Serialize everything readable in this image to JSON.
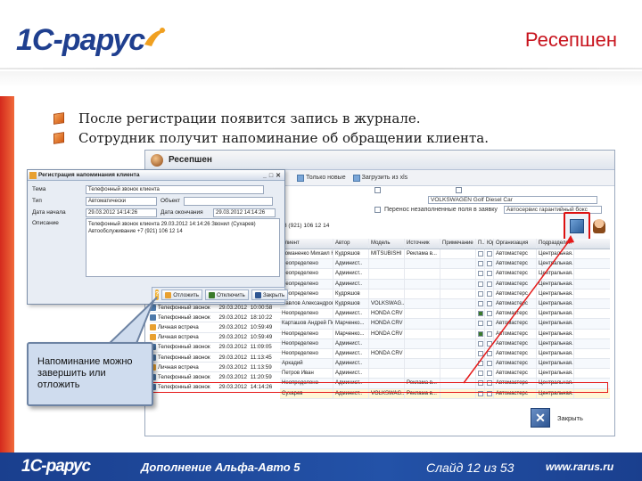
{
  "header": {
    "logo_text": "1С-рарус",
    "slide_title": "Ресепшен"
  },
  "bullets": [
    "После регистрации появится запись в журнале.",
    "Сотрудник получит напоминание об обращении клиента."
  ],
  "app_window": {
    "title": "Ресепшен",
    "toolbar": [
      "Только новые",
      "Загрузить из xls"
    ],
    "filters": {
      "interest_value": "VOLKSWAGEN Golf Diesel Car",
      "phone": "8 (921) 106 12 14",
      "checkbox_label": "Перенос незаполненные поля в заявку",
      "field_value": "Автосервис гарантийный бокс"
    },
    "table": {
      "columns": [
        "Клиент",
        "Автор",
        "Модель",
        "Источник",
        "Примечание",
        "П..",
        "Юр",
        "Организация",
        "Подразделе.."
      ],
      "rows": [
        [
          "Романенко Михаил Юрьевич",
          "Кудряшов",
          "MITSUBISHI",
          "Реклама в...",
          "",
          "",
          "",
          "Автомастерс",
          "Центральная..."
        ],
        [
          "Неопределено",
          "Админист..",
          "",
          "",
          "",
          "",
          "",
          "Автомастерс",
          "Центральная..."
        ],
        [
          "Неопределено",
          "Админист..",
          "",
          "",
          "",
          "",
          "",
          "Автомастерс",
          "Центральная..."
        ],
        [
          "Неопределено",
          "Админист..",
          "",
          "",
          "",
          "",
          "",
          "Автомастерс",
          "Центральная..."
        ],
        [
          "Неопределено",
          "Кудряшов",
          "",
          "",
          "",
          "",
          "",
          "Автомастерс",
          "Центральная..."
        ],
        [
          "Павлов Александрович",
          "Кудряшов",
          "VOLKSWAG...",
          "",
          "",
          "",
          "",
          "Автомастерс",
          "Центральная..."
        ],
        [
          "Неопределено",
          "Админист..",
          "HONDA CRV",
          "",
          "",
          "",
          "",
          "Автомастерс",
          "Центральная..."
        ],
        [
          "Карташов Андрей Петрович",
          "Марченко...",
          "HONDA CRV",
          "",
          "",
          "",
          "",
          "Автомастерс",
          "Центральная..."
        ],
        [
          "Неопределено",
          "Марченко...",
          "HONDA CRV",
          "",
          "",
          "",
          "",
          "Автомастерс",
          "Центральная..."
        ],
        [
          "Неопределено",
          "Админист..",
          "",
          "",
          "",
          "",
          "",
          "Автомастерс",
          "Центральная..."
        ],
        [
          "Неопределено",
          "Админист..",
          "HONDA CRV",
          "",
          "",
          "",
          "",
          "Автомастерс",
          "Центральная..."
        ],
        [
          "Аркадий",
          "Админист..",
          "",
          "",
          "",
          "",
          "",
          "Автомастерс",
          "Центральная..."
        ],
        [
          "Петров Иван",
          "Админист..",
          "",
          "",
          "",
          "",
          "",
          "Автомастерс",
          "Центральная..."
        ],
        [
          "Неопределено",
          "Админист..",
          "",
          "Реклама в...",
          "",
          "",
          "",
          "Автомастерс",
          "Центральная..."
        ],
        [
          "Сухарев",
          "Админист..",
          "VOLKSWAG...",
          "Реклама в...",
          "",
          "",
          "",
          "Автомастерс",
          "Центральная..."
        ]
      ],
      "checked_rows": [
        6,
        8
      ]
    },
    "event_list": [
      {
        "type": "Телефонный звонок",
        "date": "29.03.2012",
        "time": "10:00:58"
      },
      {
        "type": "Телефонный звонок",
        "date": "29.03.2012",
        "time": "18:10:22"
      },
      {
        "type": "Личная встреча",
        "date": "29.03.2012",
        "time": "10:59:49"
      },
      {
        "type": "Личная встреча",
        "date": "29.03.2012",
        "time": "10:59:49"
      },
      {
        "type": "Телефонный звонок",
        "date": "29.03.2012",
        "time": "11:09:05"
      },
      {
        "type": "Телефонный звонок",
        "date": "29.03.2012",
        "time": "11:13:45"
      },
      {
        "type": "Личная встреча",
        "date": "29.03.2012",
        "time": "11:13:59"
      },
      {
        "type": "Телефонный звонок",
        "date": "29.03.2012",
        "time": "11:20:59"
      },
      {
        "type": "Телефонный звонок",
        "date": "29.03.2012",
        "time": "14:14:26"
      }
    ],
    "close_label": "Закрыть"
  },
  "dialog": {
    "title": "Регистрация напоминания клиента",
    "fields": [
      {
        "label": "Тема",
        "value": "Телефонный звонок клиента"
      },
      {
        "label": "Тип",
        "value": "Автоматически",
        "extra_label": "Объект",
        "extra_value": ""
      },
      {
        "label": "Дата начала",
        "value": "29.03.2012 14:14:26",
        "extra_label": "Дата окончания",
        "extra_value": "29.03.2012 14:14:26"
      }
    ],
    "description_label": "Описание",
    "description_text": "Телефонный звонок клиента 29.03.2012 14:14:26 Звонил (Сухарев) Автообслуживание +7 (921) 106 12 14",
    "footer_buttons": [
      "Отложить",
      "Отключить",
      "Закрыть"
    ]
  },
  "callout": {
    "text": "Напоминание можно завершить или отложить"
  },
  "footer": {
    "logo_text": "1С-рарус",
    "addon": "Дополнение Альфа-Авто 5",
    "slide": "Слайд 12 из 53",
    "site": "www.rarus.ru"
  },
  "colors": {
    "accent_red": "#c8141e",
    "brand_blue": "#1f3f8f",
    "highlight_red": "#e51a1a",
    "accent_orange": "#f06a3a"
  }
}
